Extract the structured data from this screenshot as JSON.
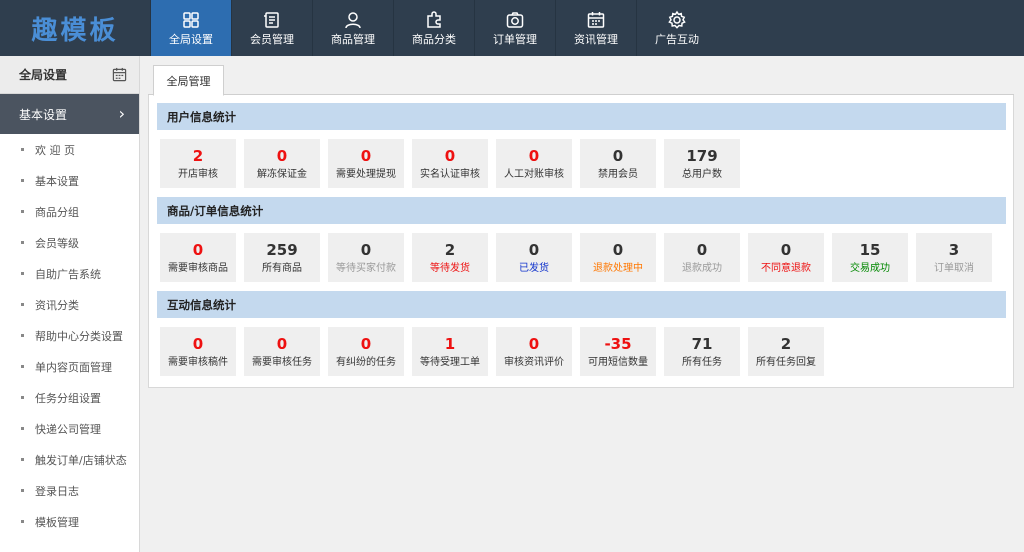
{
  "logo": {
    "text": "趣模板"
  },
  "nav": [
    {
      "label": "全局设置",
      "icon": "grid-icon",
      "active": true
    },
    {
      "label": "会员管理",
      "icon": "document-icon"
    },
    {
      "label": "商品管理",
      "icon": "user-icon"
    },
    {
      "label": "商品分类",
      "icon": "puzzle-icon"
    },
    {
      "label": "订单管理",
      "icon": "camera-icon"
    },
    {
      "label": "资讯管理",
      "icon": "calendar-icon"
    },
    {
      "label": "广告互动",
      "icon": "gear-icon"
    }
  ],
  "sidebar": {
    "title": "全局设置",
    "section": "基本设置",
    "items": [
      "欢 迎 页",
      "基本设置",
      "商品分组",
      "会员等级",
      "自助广告系统",
      "资讯分类",
      "帮助中心分类设置",
      "单内容页面管理",
      "任务分组设置",
      "快递公司管理",
      "触发订单/店铺状态",
      "登录日志",
      "模板管理"
    ]
  },
  "tab": {
    "label": "全局管理"
  },
  "colors": {
    "red": "#ee1111",
    "dark": "#333333",
    "gray": "#999999",
    "blue": "#1133cc",
    "orange": "#ff7700",
    "green": "#008800"
  },
  "sections": [
    {
      "title": "用户信息统计",
      "cards": [
        {
          "value": "2",
          "label": "开店审核",
          "numColor": "red",
          "labColor": "dark"
        },
        {
          "value": "0",
          "label": "解冻保证金",
          "numColor": "red",
          "labColor": "dark"
        },
        {
          "value": "0",
          "label": "需要处理提现",
          "numColor": "red",
          "labColor": "dark"
        },
        {
          "value": "0",
          "label": "实名认证审核",
          "numColor": "red",
          "labColor": "dark"
        },
        {
          "value": "0",
          "label": "人工对账审核",
          "numColor": "red",
          "labColor": "dark"
        },
        {
          "value": "0",
          "label": "禁用会员",
          "numColor": "dark",
          "labColor": "dark"
        },
        {
          "value": "179",
          "label": "总用户数",
          "numColor": "dark",
          "labColor": "dark"
        }
      ]
    },
    {
      "title": "商品/订单信息统计",
      "cards": [
        {
          "value": "0",
          "label": "需要审核商品",
          "numColor": "red",
          "labColor": "dark"
        },
        {
          "value": "259",
          "label": "所有商品",
          "numColor": "dark",
          "labColor": "dark"
        },
        {
          "value": "0",
          "label": "等待买家付款",
          "numColor": "dark",
          "labColor": "gray"
        },
        {
          "value": "2",
          "label": "等待发货",
          "numColor": "dark",
          "labColor": "red"
        },
        {
          "value": "0",
          "label": "已发货",
          "numColor": "dark",
          "labColor": "blue"
        },
        {
          "value": "0",
          "label": "退款处理中",
          "numColor": "dark",
          "labColor": "orange"
        },
        {
          "value": "0",
          "label": "退款成功",
          "numColor": "dark",
          "labColor": "gray"
        },
        {
          "value": "0",
          "label": "不同意退款",
          "numColor": "dark",
          "labColor": "red"
        },
        {
          "value": "15",
          "label": "交易成功",
          "numColor": "dark",
          "labColor": "green"
        },
        {
          "value": "3",
          "label": "订单取消",
          "numColor": "dark",
          "labColor": "gray"
        }
      ]
    },
    {
      "title": "互动信息统计",
      "cards": [
        {
          "value": "0",
          "label": "需要审核稿件",
          "numColor": "red",
          "labColor": "dark"
        },
        {
          "value": "0",
          "label": "需要审核任务",
          "numColor": "red",
          "labColor": "dark"
        },
        {
          "value": "0",
          "label": "有纠纷的任务",
          "numColor": "red",
          "labColor": "dark"
        },
        {
          "value": "1",
          "label": "等待受理工单",
          "numColor": "red",
          "labColor": "dark"
        },
        {
          "value": "0",
          "label": "审核资讯评价",
          "numColor": "red",
          "labColor": "dark"
        },
        {
          "value": "-35",
          "label": "可用短信数量",
          "numColor": "red",
          "labColor": "dark"
        },
        {
          "value": "71",
          "label": "所有任务",
          "numColor": "dark",
          "labColor": "dark"
        },
        {
          "value": "2",
          "label": "所有任务回复",
          "numColor": "dark",
          "labColor": "dark"
        }
      ]
    }
  ]
}
